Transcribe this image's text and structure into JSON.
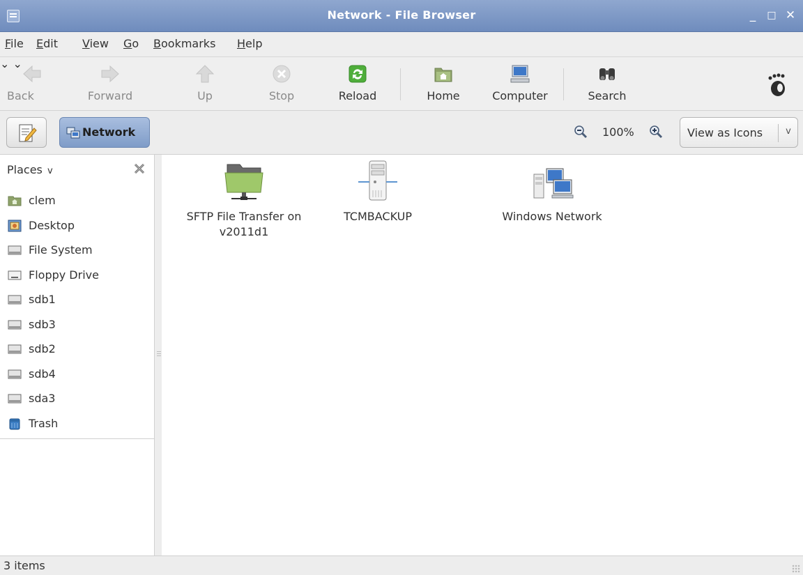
{
  "window": {
    "title": "Network - File Browser"
  },
  "menu": {
    "items": [
      {
        "mnemonic": "F",
        "rest": "ile"
      },
      {
        "mnemonic": "E",
        "rest": "dit"
      },
      {
        "mnemonic": "V",
        "rest": "iew"
      },
      {
        "mnemonic": "G",
        "rest": "o"
      },
      {
        "mnemonic": "B",
        "rest": "ookmarks"
      },
      {
        "mnemonic": "H",
        "rest": "elp"
      }
    ]
  },
  "toolbar": {
    "back": "Back",
    "forward": "Forward",
    "up": "Up",
    "stop": "Stop",
    "reload": "Reload",
    "home": "Home",
    "computer": "Computer",
    "search": "Search",
    "dropdown_glyph": "⌄"
  },
  "location": {
    "path_button": "Network",
    "zoom_level": "100%",
    "view_mode": "View as Icons",
    "view_chevron": "v"
  },
  "sidebar": {
    "header": "Places",
    "header_chevron": "v",
    "items": [
      {
        "label": "clem",
        "icon": "home-folder-icon"
      },
      {
        "label": "Desktop",
        "icon": "desktop-icon"
      },
      {
        "label": "File System",
        "icon": "drive-icon"
      },
      {
        "label": "Floppy Drive",
        "icon": "floppy-icon"
      },
      {
        "label": "sdb1",
        "icon": "drive-icon"
      },
      {
        "label": "sdb3",
        "icon": "drive-icon"
      },
      {
        "label": "sdb2",
        "icon": "drive-icon"
      },
      {
        "label": "sdb4",
        "icon": "drive-icon"
      },
      {
        "label": "sda3",
        "icon": "drive-icon"
      },
      {
        "label": "Trash",
        "icon": "trash-icon"
      }
    ]
  },
  "files": [
    {
      "line1": "SFTP File Transfer on",
      "line2": "v2011d1",
      "icon": "network-folder-icon"
    },
    {
      "line1": "TCMBACKUP",
      "line2": "",
      "icon": "server-icon"
    },
    {
      "line1": "Windows Network",
      "line2": "",
      "icon": "windows-network-icon"
    }
  ],
  "status": {
    "text": "3 items"
  },
  "colors": {
    "titlebar": "#7f9ac7",
    "selected_path": "#8ea9d2",
    "folder_green": "#9fc86a"
  }
}
